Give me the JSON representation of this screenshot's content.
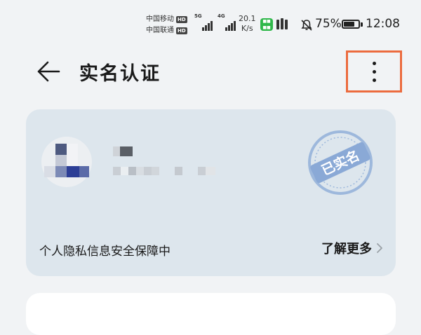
{
  "status_bar": {
    "carrier1": "中国移动",
    "carrier2": "中国联通",
    "hd": "HD",
    "net1": "5G",
    "net2": "4G",
    "speed_value": "20.1",
    "speed_unit": "K/s",
    "battery_percent": "75%",
    "battery_level": 0.75,
    "time": "12:08"
  },
  "header": {
    "title": "实名认证"
  },
  "id_card": {
    "stamp_text": "已实名",
    "privacy_text": "个人隐私信息安全保障中",
    "learn_more": "了解更多",
    "colors": {
      "card_bg": "#dde6ed",
      "stamp": "#9db8dc"
    }
  },
  "accent": {
    "highlight_border": "#ec6b3e"
  }
}
